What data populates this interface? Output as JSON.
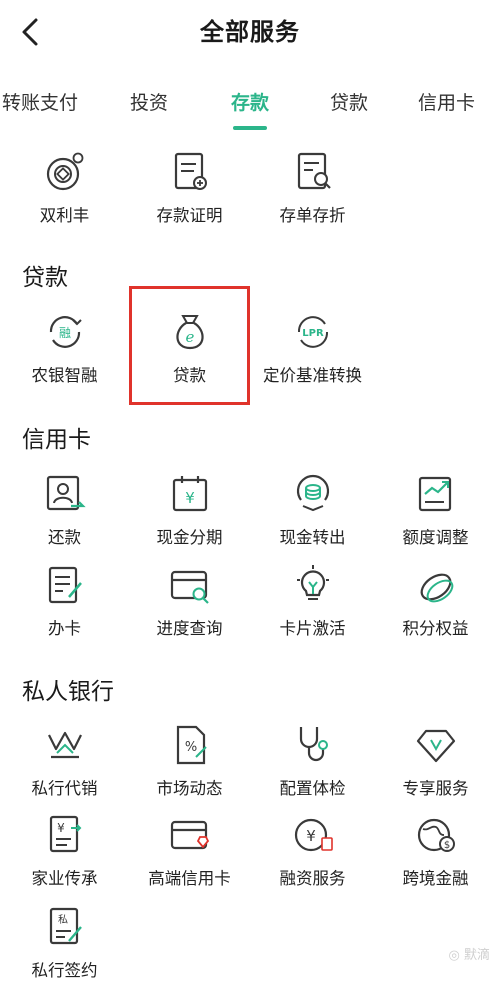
{
  "header": {
    "title": "全部服务"
  },
  "tabs": [
    {
      "label": "转账支付",
      "active": false
    },
    {
      "label": "投资",
      "active": false
    },
    {
      "label": "存款",
      "active": true
    },
    {
      "label": "贷款",
      "active": false
    },
    {
      "label": "信用卡",
      "active": false
    }
  ],
  "deposit": {
    "items": [
      {
        "label": "双利丰",
        "icon": "coin-ring-icon"
      },
      {
        "label": "存款证明",
        "icon": "document-add-icon"
      },
      {
        "label": "存单存折",
        "icon": "search-document-icon"
      }
    ]
  },
  "loans": {
    "title": "贷款",
    "items": [
      {
        "label": "农银智融",
        "icon": "rong-circle-icon"
      },
      {
        "label": "贷款",
        "icon": "money-bag-icon"
      },
      {
        "label": "定价基准转换",
        "icon": "lpr-icon"
      }
    ]
  },
  "credit_card": {
    "title": "信用卡",
    "items": [
      {
        "label": "还款",
        "icon": "repay-user-icon"
      },
      {
        "label": "现金分期",
        "icon": "yen-calendar-icon"
      },
      {
        "label": "现金转出",
        "icon": "coin-stack-icon"
      },
      {
        "label": "额度调整",
        "icon": "trend-document-icon"
      },
      {
        "label": "办卡",
        "icon": "form-pen-icon"
      },
      {
        "label": "进度查询",
        "icon": "card-search-icon"
      },
      {
        "label": "卡片激活",
        "icon": "lightbulb-icon"
      },
      {
        "label": "积分权益",
        "icon": "tag-icon"
      }
    ]
  },
  "private_banking": {
    "title": "私人银行",
    "items": [
      {
        "label": "私行代销",
        "icon": "crown-icon"
      },
      {
        "label": "市场动态",
        "icon": "percent-document-icon"
      },
      {
        "label": "配置体检",
        "icon": "stethoscope-icon"
      },
      {
        "label": "专享服务",
        "icon": "diamond-icon"
      },
      {
        "label": "家业传承",
        "icon": "yen-document-icon"
      },
      {
        "label": "高端信用卡",
        "icon": "premium-card-icon"
      },
      {
        "label": "融资服务",
        "icon": "yen-circle-icon"
      },
      {
        "label": "跨境金融",
        "icon": "globe-dollar-icon"
      },
      {
        "label": "私行签约",
        "icon": "sign-document-icon"
      }
    ]
  },
  "colors": {
    "accent": "#2bb58a",
    "highlight": "#e0332b",
    "icon_stroke": "#3a3a3a"
  },
  "watermark": "◎ 默滴"
}
